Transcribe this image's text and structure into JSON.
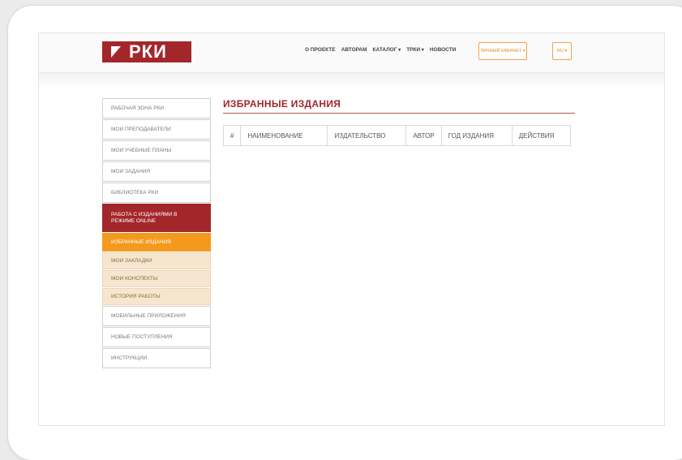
{
  "header": {
    "logo_text": "РКИ",
    "nav": [
      {
        "label": "О ПРОЕКТЕ",
        "dropdown": false
      },
      {
        "label": "АВТОРАМ",
        "dropdown": false
      },
      {
        "label": "КАТАЛОГ",
        "dropdown": true
      },
      {
        "label": "ТРКИ",
        "dropdown": true
      },
      {
        "label": "НОВОСТИ",
        "dropdown": false
      }
    ],
    "cabinet_label": "ЛИЧНЫЙ КАБИНЕТ ▾",
    "lang_label": "RU ▾"
  },
  "sidebar": {
    "items": [
      {
        "label": "РАБОЧАЯ ЗОНА РКИ",
        "state": "normal"
      },
      {
        "label": "МОИ ПРЕПОДАВАТЕЛИ",
        "state": "normal"
      },
      {
        "label": "МОИ УЧЕБНЫЕ ПЛАНЫ",
        "state": "normal"
      },
      {
        "label": "МОИ ЗАДАНИЯ",
        "state": "normal"
      },
      {
        "label": "БИБЛИОТЕКА РКИ",
        "state": "normal"
      },
      {
        "label": "РАБОТА С ИЗДАНИЯМИ В РЕЖИМЕ ONLINE",
        "state": "active"
      },
      {
        "label": "ИЗБРАННЫЕ ИЗДАНИЯ",
        "state": "sub-highlight"
      },
      {
        "label": "МОИ ЗАКЛАДКИ",
        "state": "sub"
      },
      {
        "label": "МОИ КОНСПЕКТЫ",
        "state": "sub"
      },
      {
        "label": "ИСТОРИЯ РАБОТЫ",
        "state": "sub"
      },
      {
        "label": "МОБИЛЬНЫЕ ПРИЛОЖЕНИЯ",
        "state": "normal"
      },
      {
        "label": "НОВЫЕ ПОСТУПЛЕНИЯ",
        "state": "normal"
      },
      {
        "label": "ИНСТРУКЦИИ",
        "state": "normal"
      }
    ]
  },
  "main": {
    "title": "ИЗБРАННЫЕ ИЗДАНИЯ",
    "table_headers": [
      "#",
      "НАИМЕНОВАНИЕ",
      "ИЗДАТЕЛЬСТВО",
      "АВТОР",
      "ГОД ИЗДАНИЯ",
      "ДЕЙСТВИЯ"
    ]
  },
  "colors": {
    "brand": "#a3262b",
    "accent": "#f39a1e",
    "sub_bg": "#f7e6cf"
  }
}
